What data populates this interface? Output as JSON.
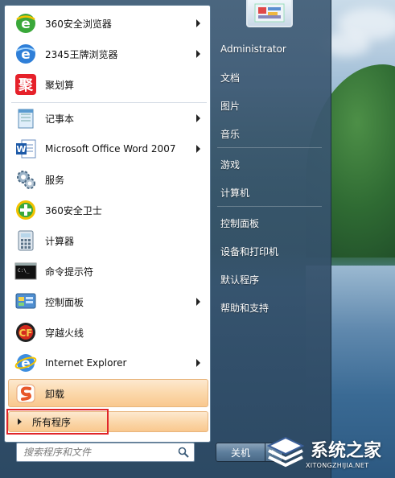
{
  "programs": [
    {
      "label": "360安全浏览器",
      "icon": "360-browser-icon",
      "submenu": true
    },
    {
      "label": "2345王牌浏览器",
      "icon": "2345-browser-icon",
      "submenu": true
    },
    {
      "label": "聚划算",
      "icon": "juhuasuan-icon",
      "submenu": false
    },
    {
      "label": "记事本",
      "icon": "notepad-icon",
      "submenu": true
    },
    {
      "label": "Microsoft Office Word 2007",
      "icon": "word-icon",
      "submenu": true
    },
    {
      "label": "服务",
      "icon": "services-gear-icon",
      "submenu": false
    },
    {
      "label": "360安全卫士",
      "icon": "360-safe-icon",
      "submenu": false
    },
    {
      "label": "计算器",
      "icon": "calculator-icon",
      "submenu": false
    },
    {
      "label": "命令提示符",
      "icon": "cmd-icon",
      "submenu": false
    },
    {
      "label": "控制面板",
      "icon": "control-panel-icon",
      "submenu": true
    },
    {
      "label": "穿越火线",
      "icon": "crossfire-icon",
      "submenu": false
    },
    {
      "label": "Internet Explorer",
      "icon": "ie-icon",
      "submenu": true
    },
    {
      "label": "卸载",
      "icon": "uninstall-icon",
      "submenu": false
    }
  ],
  "all_programs": "所有程序",
  "search": {
    "placeholder": "搜索程序和文件"
  },
  "right_items": [
    {
      "label": "Administrator"
    },
    {
      "label": "文档"
    },
    {
      "label": "图片"
    },
    {
      "label": "音乐"
    },
    {
      "label": "游戏"
    },
    {
      "label": "计算机"
    },
    {
      "label": "控制面板"
    },
    {
      "label": "设备和打印机"
    },
    {
      "label": "默认程序"
    },
    {
      "label": "帮助和支持"
    }
  ],
  "shutdown": {
    "label": "关机"
  },
  "watermark": {
    "title": "系统之家",
    "url": "XITONGZHIJIA.NET"
  },
  "colors": {
    "highlight": "#fbd8ab",
    "red_box": "#e0262a",
    "menu_bg": "#3f5d7a"
  }
}
